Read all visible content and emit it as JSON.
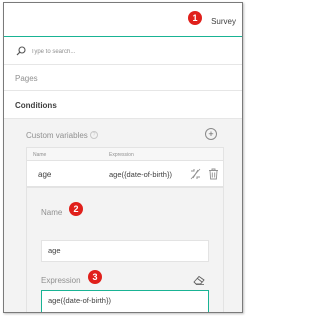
{
  "header": {
    "title": "Survey"
  },
  "search": {
    "placeholder": "Type to search..."
  },
  "nav": {
    "pages_label": "Pages",
    "conditions_label": "Conditions"
  },
  "custom_variables": {
    "title": "Custom variables",
    "help_glyph": "?",
    "add_glyph": "+",
    "columns": {
      "name": "Name",
      "expression": "Expression"
    },
    "rows": [
      {
        "name": "age",
        "expression": "age({date-of-birth})"
      }
    ],
    "detail": {
      "name_label": "Name",
      "name_value": "age",
      "expression_label": "Expression",
      "expression_value": "age({date-of-birth})"
    }
  },
  "annotations": {
    "badge_1": "1",
    "badge_2": "2",
    "badge_3": "3"
  },
  "colors": {
    "accent": "#19b394",
    "badge": "#e0201b"
  }
}
